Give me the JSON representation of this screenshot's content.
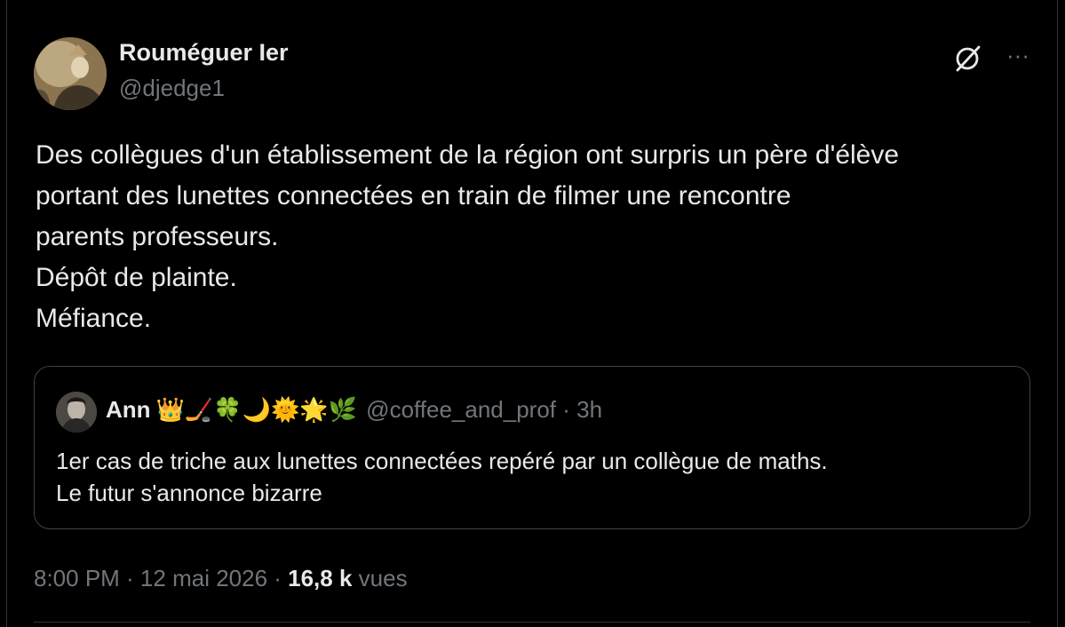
{
  "author": {
    "display_name": "Rouméguer Ier",
    "handle": "@djedge1"
  },
  "header_icons": {
    "grok": "grok-icon",
    "more": "more-icon",
    "more_glyph": "···"
  },
  "tweet": {
    "lines": [
      "Des collègues d'un établissement de la région ont surpris un père d'élève",
      "portant des lunettes connectées en train de filmer une rencontre",
      "parents professeurs.",
      "Dépôt de plainte.",
      "Méfiance."
    ]
  },
  "quote": {
    "name": "Ann",
    "emojis": "👑🏒🍀🌙🌞🌟🌿",
    "handle_time": "@coffee_and_prof · 3h",
    "lines": [
      "1er cas de triche aux lunettes connectées repéré par un collègue de maths.",
      "Le futur s'annonce bizarre"
    ]
  },
  "meta": {
    "time_date": "8:00 PM · 12 mai 2026 · ",
    "views_count": "16,8 k",
    "views_label": " vues"
  },
  "colors": {
    "background": "#000000",
    "text": "#e7e9ea",
    "secondary": "#71767b",
    "border": "#2f3336"
  }
}
